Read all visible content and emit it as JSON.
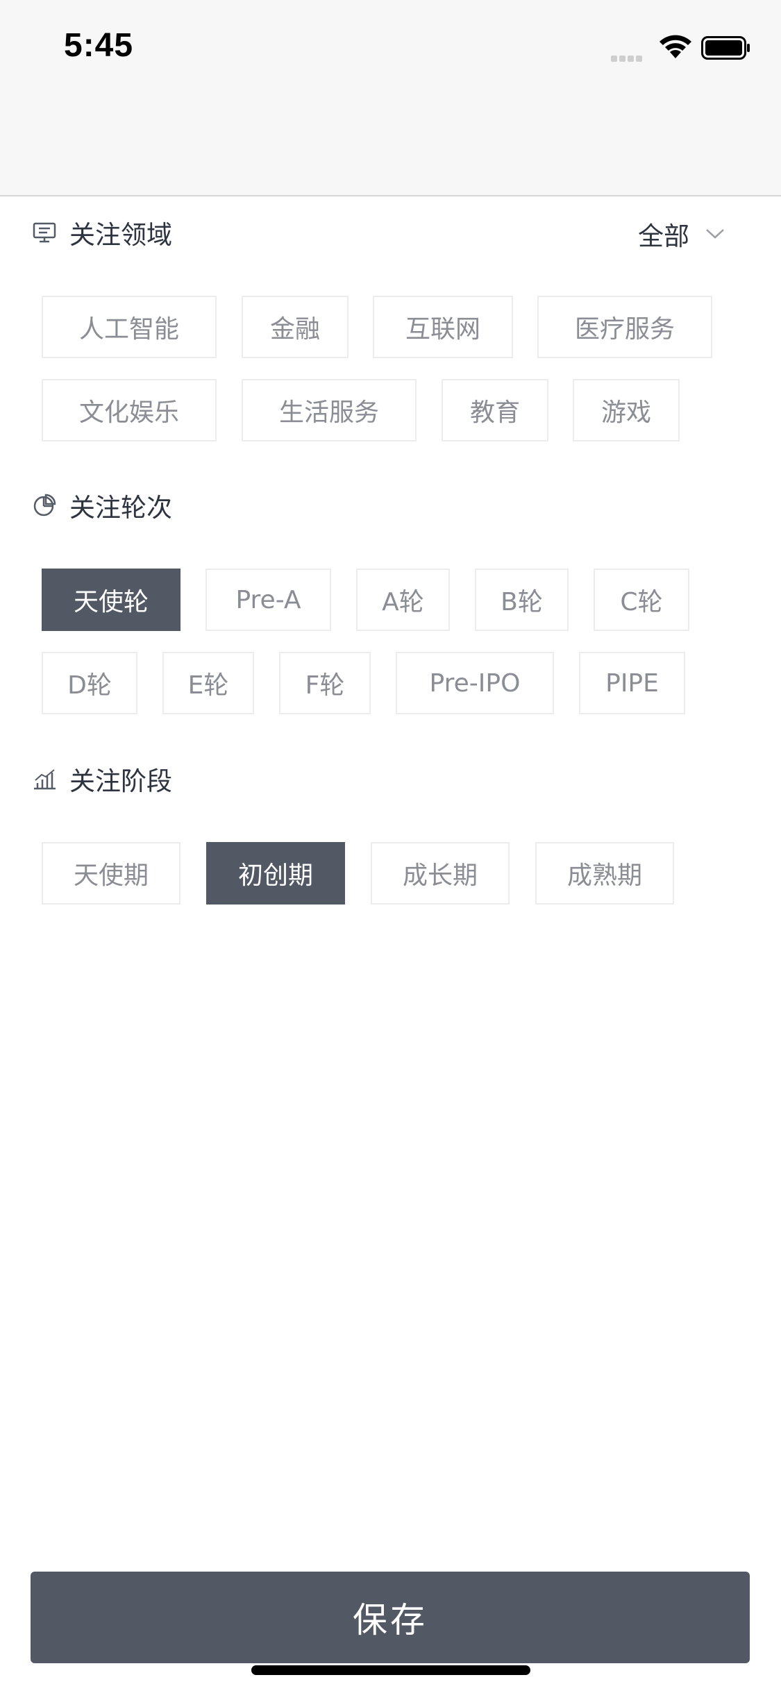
{
  "status": {
    "time": "5:45"
  },
  "domain": {
    "title": "关注领域",
    "filter": "全部",
    "tags": [
      "人工智能",
      "金融",
      "互联网",
      "医疗服务",
      "文化娱乐",
      "生活服务",
      "教育",
      "游戏"
    ],
    "selected": []
  },
  "round": {
    "title": "关注轮次",
    "tags": [
      "天使轮",
      "Pre-A",
      "A轮",
      "B轮",
      "C轮",
      "D轮",
      "E轮",
      "F轮",
      "Pre-IPO",
      "PIPE"
    ],
    "selected": [
      0
    ]
  },
  "stage": {
    "title": "关注阶段",
    "tags": [
      "天使期",
      "初创期",
      "成长期",
      "成熟期"
    ],
    "selected": [
      1
    ]
  },
  "save_label": "保存",
  "icons": [
    "signal-icon",
    "wifi-icon",
    "battery-icon",
    "monitor-icon",
    "chevron-down-icon",
    "pie-chart-icon",
    "bar-chart-icon"
  ]
}
